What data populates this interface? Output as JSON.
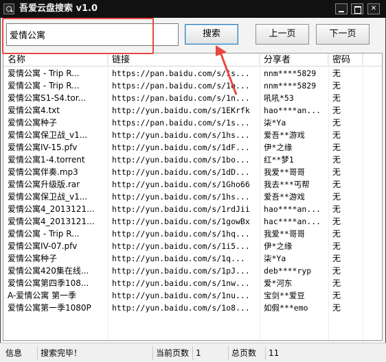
{
  "window": {
    "title": "吾爱云盘搜索 v1.0",
    "app_icon": "search-icon"
  },
  "search": {
    "value": "爱情公寓",
    "button_label": "搜索",
    "prev_label": "上一页",
    "next_label": "下一页"
  },
  "accent": {
    "highlight": "#e8473f"
  },
  "table": {
    "columns": [
      "名称",
      "链接",
      "分享者",
      "密码"
    ],
    "rows": [
      [
        "爱情公寓 - Trip R...",
        "https://pan.baidu.com/s/1s...",
        "nnm****5829",
        "无"
      ],
      [
        "爱情公寓 - Trip R...",
        "https://pan.baidu.com/s/1o...",
        "nnm****5829",
        "无"
      ],
      [
        "爱情公寓S1-S4.tor...",
        "https://pan.baidu.com/s/1n...",
        "吼吼*53",
        "无"
      ],
      [
        "爱情公寓4.txt",
        "http://yun.baidu.com/s/1EKrfk",
        "hao****an...",
        "无"
      ],
      [
        "爱情公寓种子",
        "https://pan.baidu.com/s/1s...",
        "柒*Ya",
        "无"
      ],
      [
        "爱情公寓保卫战_v1...",
        "http://yun.baidu.com/s/1hs...",
        "爱吾**游戏",
        "无"
      ],
      [
        "爱情公寓IV-15.pfv",
        "http://yun.baidu.com/s/1dF...",
        "伊*之缘",
        "无"
      ],
      [
        "爱情公寓1-4.torrent",
        "http://yun.baidu.com/s/1bo...",
        "红**梦1",
        "无"
      ],
      [
        "爱情公寓伴奏.mp3",
        "http://yun.baidu.com/s/1dD...",
        "我爱**哥哥",
        "无"
      ],
      [
        "爱情公寓升级版.rar",
        "http://yun.baidu.com/s/1Gho66",
        "我去***丐帮",
        "无"
      ],
      [
        "爱情公寓保卫战_v1...",
        "http://yun.baidu.com/s/1hs...",
        "爱吾**游戏",
        "无"
      ],
      [
        "爱情公寓4_2013121...",
        "http://yun.baidu.com/s/1rdJii",
        "hao****an...",
        "无"
      ],
      [
        "爱情公寓4_2013121...",
        "http://yun.baidu.com/s/1gowBx",
        "hac****an...",
        "无"
      ],
      [
        "爱情公寓 - Trip R...",
        "http://yun.baidu.com/s/1hq...",
        "我爱**哥哥",
        "无"
      ],
      [
        "爱情公寓IV-07.pfv",
        "http://yun.baidu.com/s/1i5...",
        "伊*之缘",
        "无"
      ],
      [
        "爱情公寓种子",
        "http://yun.baidu.com/s/1q...",
        "柒*Ya",
        "无"
      ],
      [
        "爱情公寓420集在线...",
        "http://yun.baidu.com/s/1pJ...",
        "deb****ryp",
        "无"
      ],
      [
        "爱情公寓第四季108...",
        "http://yun.baidu.com/s/1nw...",
        "爱*河东",
        "无"
      ],
      [
        "A-爱情公寓 第一季",
        "http://yun.baidu.com/s/1nu...",
        "宝剑**爱豆",
        "无"
      ],
      [
        "爱情公寓第一季1080P",
        "http://yun.baidu.com/s/1o8...",
        "如假***emo",
        "无"
      ]
    ]
  },
  "status": {
    "info_label": "信息",
    "info_value": "搜索完毕！",
    "current_page_label": "当前页数",
    "current_page_value": "1",
    "total_pages_label": "总页数",
    "total_pages_value": "11"
  }
}
